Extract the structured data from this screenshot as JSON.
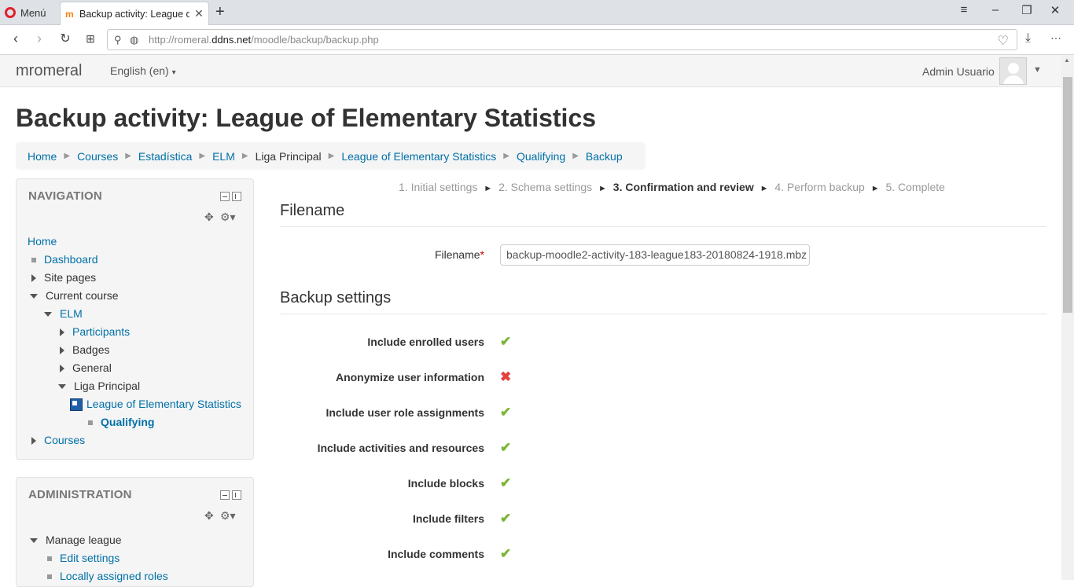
{
  "browser": {
    "menu_label": "Menú",
    "tab_title": "Backup activity: League of Elementary Statistics",
    "url_prefix": "http://romeral.",
    "url_domain": "ddns.net",
    "url_path": "/moodle/backup/backup.php"
  },
  "navbar": {
    "brand": "mromeral",
    "language": "English (en)",
    "user_name": "Admin Usuario"
  },
  "page": {
    "title": "Backup activity: League of Elementary Statistics"
  },
  "breadcrumb": [
    {
      "label": "Home",
      "link": true
    },
    {
      "label": "Courses",
      "link": true
    },
    {
      "label": "Estadística",
      "link": true
    },
    {
      "label": "ELM",
      "link": true
    },
    {
      "label": "Liga Principal",
      "link": false
    },
    {
      "label": "League of Elementary Statistics",
      "link": true
    },
    {
      "label": "Qualifying",
      "link": true
    },
    {
      "label": "Backup",
      "link": true
    }
  ],
  "navigation": {
    "title": "NAVIGATION",
    "items": {
      "home": "Home",
      "dashboard": "Dashboard",
      "site_pages": "Site pages",
      "current_course": "Current course",
      "elm": "ELM",
      "participants": "Participants",
      "badges": "Badges",
      "general": "General",
      "liga_principal": "Liga Principal",
      "league": "League of Elementary Statistics",
      "qualifying": "Qualifying",
      "courses": "Courses"
    }
  },
  "administration": {
    "title": "ADMINISTRATION",
    "items": {
      "manage_league": "Manage league",
      "edit_settings": "Edit settings",
      "locally_assigned_roles": "Locally assigned roles"
    }
  },
  "steps": {
    "s1": "1. Initial settings",
    "s2": "2. Schema settings",
    "s3": "3. Confirmation and review",
    "s4": "4. Perform backup",
    "s5": "5. Complete",
    "separator": "►"
  },
  "filename_section": {
    "heading": "Filename",
    "label": "Filename",
    "required_mark": "*",
    "value": "backup-moodle2-activity-183-league183-20180824-1918.mbz"
  },
  "backup_settings": {
    "heading": "Backup settings",
    "items": [
      {
        "label": "Include enrolled users",
        "mark": "✔",
        "enabled": true
      },
      {
        "label": "Anonymize user information",
        "mark": "✖",
        "enabled": false
      },
      {
        "label": "Include user role assignments",
        "mark": "✔",
        "enabled": true
      },
      {
        "label": "Include activities and resources",
        "mark": "✔",
        "enabled": true
      },
      {
        "label": "Include blocks",
        "mark": "✔",
        "enabled": true
      },
      {
        "label": "Include filters",
        "mark": "✔",
        "enabled": true
      },
      {
        "label": "Include comments",
        "mark": "✔",
        "enabled": true
      }
    ]
  }
}
